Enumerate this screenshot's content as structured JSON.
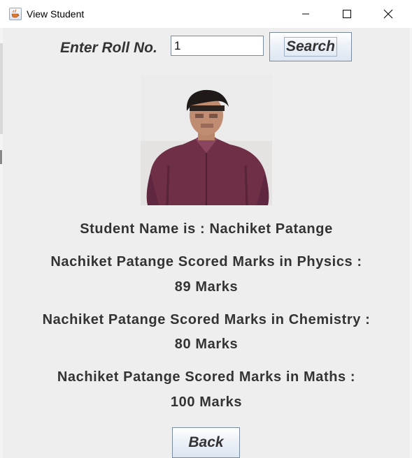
{
  "window": {
    "title": "View Student"
  },
  "form": {
    "roll_label": "Enter Roll No.",
    "roll_value": "1",
    "search_label": "Search",
    "back_label": "Back"
  },
  "student": {
    "name_line": "Student Name is :  Nachiket Patange",
    "physics_line": "Nachiket Patange Scored Marks in Physics :",
    "physics_marks": "89 Marks",
    "chemistry_line": "Nachiket Patange Scored Marks in Chemistry :",
    "chemistry_marks": "80 Marks",
    "maths_line": "Nachiket Patange Scored Marks in Maths :",
    "maths_marks": "100 Marks"
  },
  "colors": {
    "panel_bg": "#eeeeee",
    "text": "#333333",
    "shirt": "#6e2f47"
  },
  "icons": {
    "app": "java-cup-icon",
    "minimize": "minimize-icon",
    "maximize": "maximize-icon",
    "close": "close-icon"
  }
}
